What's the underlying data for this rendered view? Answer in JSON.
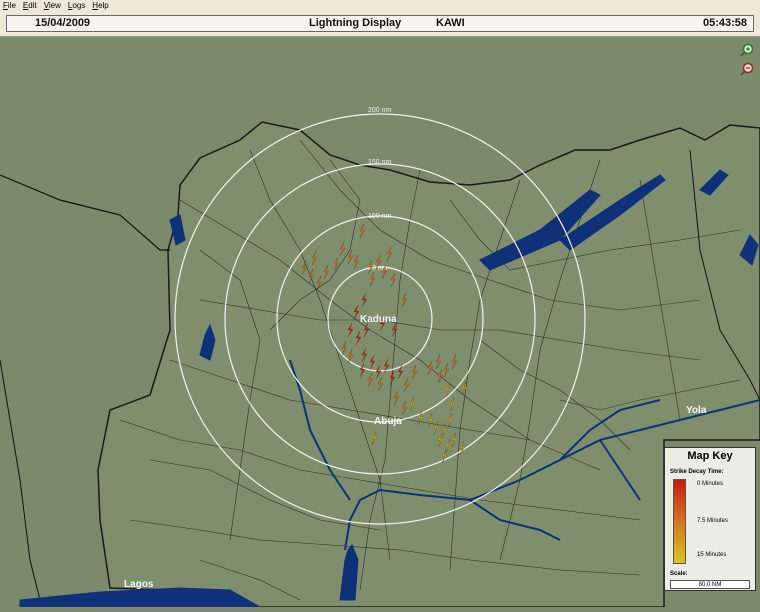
{
  "menu": [
    {
      "label": "File"
    },
    {
      "label": "Edit"
    },
    {
      "label": "View"
    },
    {
      "label": "Logs"
    },
    {
      "label": "Help"
    }
  ],
  "header": {
    "date": "15/04/2009",
    "title": "Lightning Display",
    "station": "KAWI",
    "time": "05:43:58"
  },
  "map": {
    "background_color": "#7a8a6a",
    "water_color": "#10307a",
    "range_rings": [
      {
        "label": "200 nm"
      },
      {
        "label": "150 nm"
      },
      {
        "label": "100 nm"
      },
      {
        "label": "50 nm"
      }
    ],
    "cities": [
      {
        "name": "Kaduna"
      },
      {
        "name": "Abuja"
      },
      {
        "name": "Yola"
      },
      {
        "name": "Lagos"
      }
    ]
  },
  "toolbar": {
    "zoom_in_icon": "zoom-in-icon",
    "zoom_out_icon": "zoom-out-icon"
  },
  "map_key": {
    "title": "Map Key",
    "decay_label": "Strike Decay Time:",
    "labels": [
      "0 Minutes",
      "7.5 Minutes",
      "15 Minutes"
    ],
    "colors": [
      "#c81c10",
      "#d67520",
      "#d8c51c"
    ],
    "scale_label": "Scale:",
    "scale_value": "80.0 NM"
  }
}
